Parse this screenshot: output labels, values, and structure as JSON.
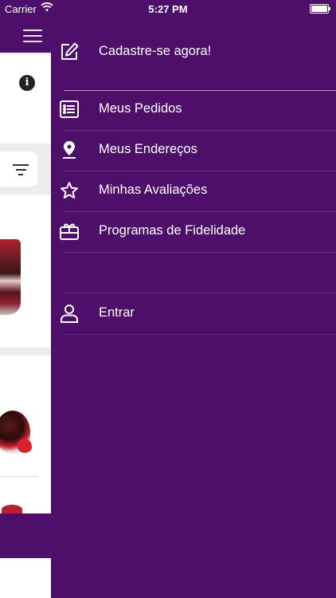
{
  "status_bar": {
    "carrier": "Carrier",
    "time": "5:27 PM"
  },
  "background": {
    "menu_icon": "hamburger-icon",
    "info_icon_glyph": "i",
    "filter_icon": "filter-icon"
  },
  "drawer": {
    "register": {
      "label": "Cadastre-se agora!",
      "icon": "edit-icon"
    },
    "items": [
      {
        "label": "Meus Pedidos",
        "icon": "list-icon"
      },
      {
        "label": "Meus Endereços",
        "icon": "location-pin-icon"
      },
      {
        "label": "Minhas Avaliações",
        "icon": "star-icon"
      },
      {
        "label": "Programas de Fidelidade",
        "icon": "gift-card-icon"
      }
    ],
    "login": {
      "label": "Entrar",
      "icon": "user-icon"
    }
  },
  "colors": {
    "primary": "#4e0f6b",
    "text": "#ffffff"
  }
}
